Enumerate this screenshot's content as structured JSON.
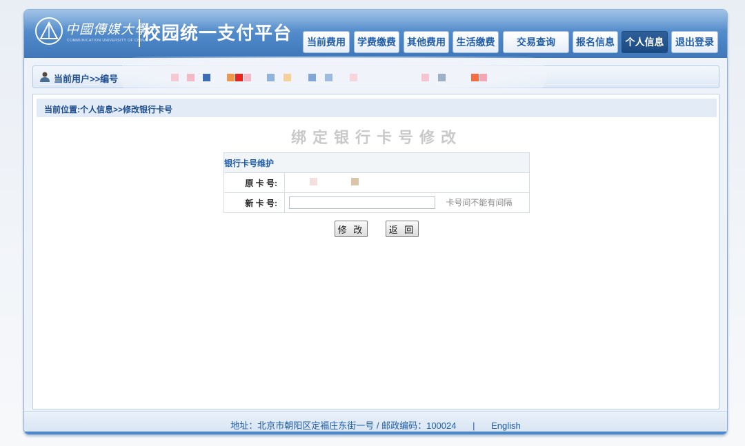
{
  "brand": {
    "calligraphy": "中國傳媒大學",
    "subtitle": "COMMUNICATION UNIVERSITY OF CHINA",
    "title": "校园统一支付平台",
    "accent": "#4f88c8"
  },
  "nav": {
    "items": [
      {
        "label": "当前费用"
      },
      {
        "label": "学费缴费"
      },
      {
        "label": "其他费用"
      },
      {
        "label": "生活缴费"
      },
      {
        "label": "交易查询"
      },
      {
        "label": "报名信息"
      },
      {
        "label": "个人信息",
        "active": true
      },
      {
        "label": "退出登录"
      }
    ]
  },
  "userbar": {
    "text": "当前用户>>编号"
  },
  "breadcrumb": {
    "text": "当前位置:个人信息>>修改银行卡号"
  },
  "form": {
    "title": "绑定银行卡号修改",
    "section_label": "银行卡号维护",
    "original_label": "原 卡 号:",
    "new_label": "新 卡 号:",
    "new_value": "",
    "hint": "卡号间不能有间隔",
    "submit_label": "修 改",
    "back_label": "返 回"
  },
  "footer": {
    "address": "地址：北京市朝阳区定福庄东街一号 / 邮政编码：100024",
    "separator": "|",
    "language_link": "English"
  }
}
